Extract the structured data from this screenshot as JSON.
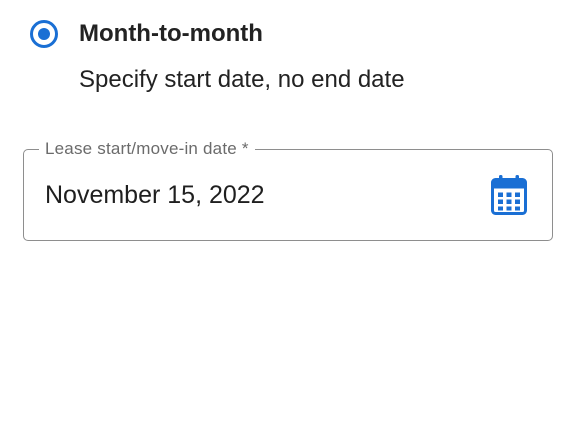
{
  "lease_option": {
    "label": "Month-to-month",
    "description": "Specify start date, no end date",
    "selected": true
  },
  "lease_start_field": {
    "label": "Lease start/move-in date *",
    "value": "November 15, 2022",
    "icon": "calendar-icon"
  },
  "colors": {
    "accent": "#1a6fd4",
    "border": "#8e8e8e",
    "label_text": "#6b6b6b",
    "text": "#1f1f1f"
  }
}
